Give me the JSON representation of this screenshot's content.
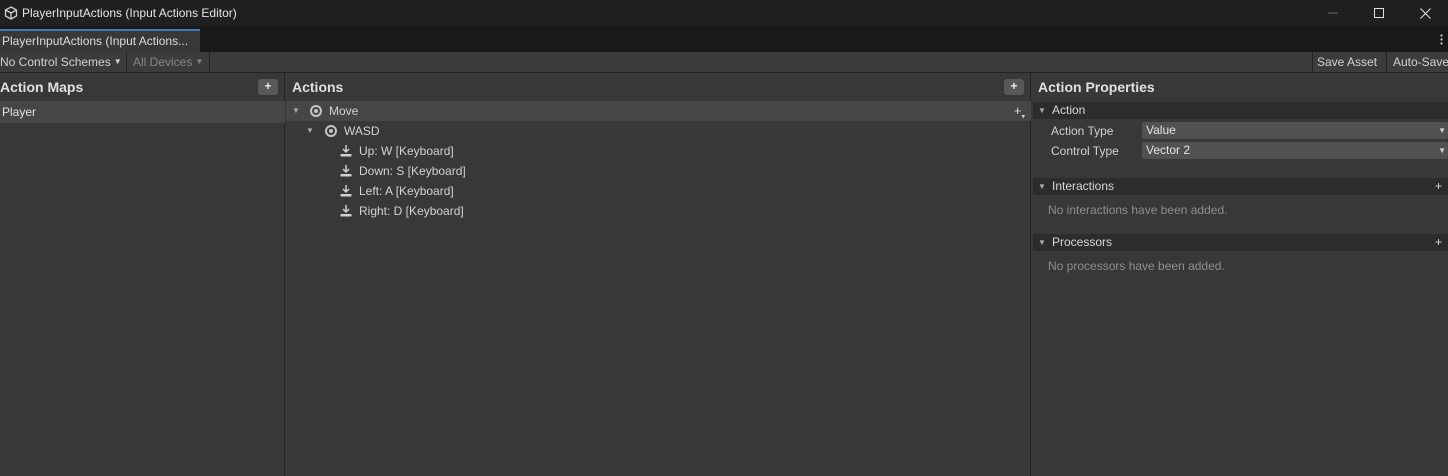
{
  "window": {
    "title": "PlayerInputActions (Input Actions Editor)",
    "minimize_glyph": "—",
    "maximize_glyph": "☐",
    "close_glyph": "✕"
  },
  "tab": {
    "label": "PlayerInputActions (Input Actions..."
  },
  "toolbar": {
    "control_schemes": "No Control Schemes",
    "devices": "All Devices",
    "save_asset": "Save Asset",
    "auto_save": "Auto-Save"
  },
  "action_maps": {
    "title": "Action Maps",
    "items": [
      {
        "label": "Player"
      }
    ]
  },
  "actions": {
    "title": "Actions",
    "tree": [
      {
        "label": "Move"
      },
      {
        "label": "WASD"
      },
      {
        "label": "Up: W [Keyboard]"
      },
      {
        "label": "Down: S [Keyboard]"
      },
      {
        "label": "Left: A [Keyboard]"
      },
      {
        "label": "Right: D [Keyboard]"
      }
    ]
  },
  "properties": {
    "title": "Action Properties",
    "action_section": "Action",
    "action_type_label": "Action Type",
    "action_type_value": "Value",
    "control_type_label": "Control Type",
    "control_type_value": "Vector 2",
    "interactions_section": "Interactions",
    "interactions_empty": "No interactions have been added.",
    "processors_section": "Processors",
    "processors_empty": "No processors have been added."
  },
  "colors": {
    "tab_accent": "#3a79bb",
    "panel_bg": "#383838",
    "selection_bg": "#464646"
  }
}
